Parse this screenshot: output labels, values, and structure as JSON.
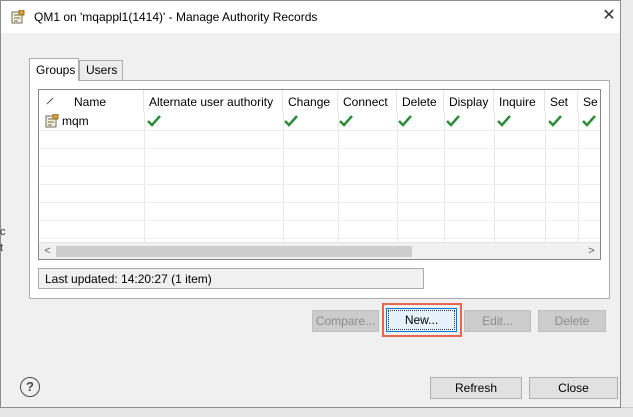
{
  "window": {
    "title": "QM1 on 'mqappl1(1414)' - Manage Authority Records",
    "close_glyph": "✕"
  },
  "tabs": [
    {
      "label": "Groups",
      "active": true
    },
    {
      "label": "Users",
      "active": false
    }
  ],
  "table": {
    "columns": [
      "Name",
      "Alternate user authority",
      "Change",
      "Connect",
      "Delete",
      "Display",
      "Inquire",
      "Set",
      "Se"
    ],
    "rows": [
      {
        "name": "mqm",
        "icon": "group-record-icon",
        "checks": [
          true,
          true,
          true,
          true,
          true,
          true,
          true,
          true
        ]
      }
    ]
  },
  "scrollbar": {
    "left_arrow": "<",
    "right_arrow": ">"
  },
  "status": {
    "text": "Last updated: 14:20:27 (1 item)"
  },
  "buttons": {
    "compare": "Compare...",
    "new": "New...",
    "edit": "Edit...",
    "delete": "Delete",
    "refresh": "Refresh",
    "close": "Close"
  },
  "help": {
    "glyph": "?"
  },
  "background": {
    "left_text_1": "c",
    "left_text_2": "t"
  },
  "colors": {
    "check": "#2e8b3a",
    "highlight": "#e8664e",
    "focus": "#0078d7"
  }
}
